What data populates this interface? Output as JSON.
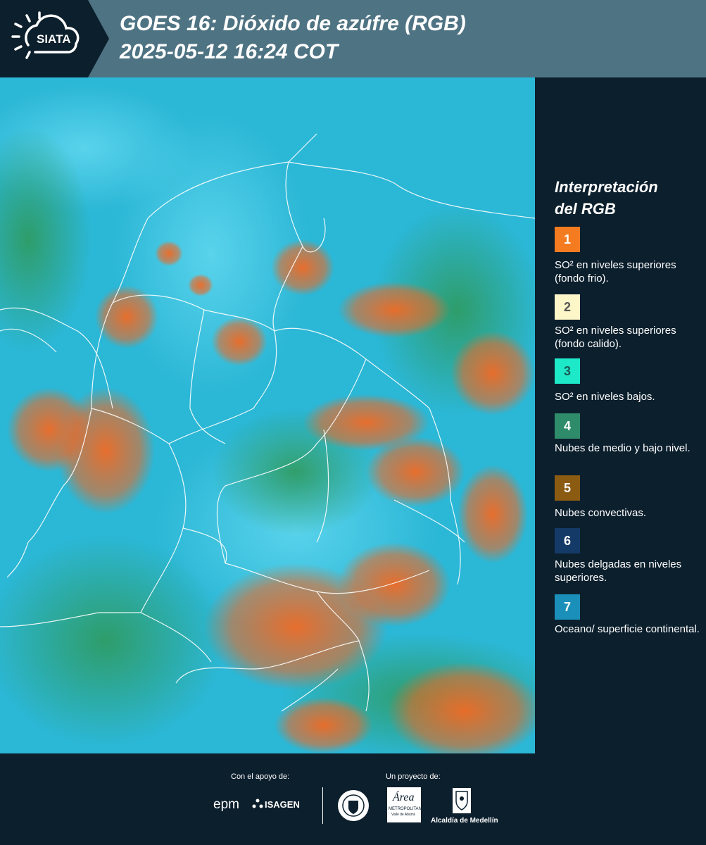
{
  "header": {
    "logo_text": "SIATA",
    "title_line1": "GOES 16: Dióxido de azúfre (RGB)",
    "title_line2": " 2025-05-12 16:24 COT"
  },
  "legend": {
    "title_line1": "Interpretación",
    "title_line2": "del RGB",
    "items": [
      {
        "num": "1",
        "color": "#f47b20",
        "text_color": "#ffffff",
        "label": "SO² en niveles superiores (fondo frio)."
      },
      {
        "num": "2",
        "color": "#fdf6c9",
        "text_color": "#555555",
        "label": "SO² en niveles superiores (fondo calido)."
      },
      {
        "num": "3",
        "color": "#1de9c9",
        "text_color": "#1a5a55",
        "label": "SO² en niveles bajos."
      },
      {
        "num": "4",
        "color": "#2e8c6a",
        "text_color": "#ffffff",
        "label": "Nubes de medio y bajo nivel."
      },
      {
        "num": "5",
        "color": "#8c5b12",
        "text_color": "#ffffff",
        "label": "Nubes convectivas."
      },
      {
        "num": "6",
        "color": "#143a68",
        "text_color": "#ffffff",
        "label": "Nubes delgadas en niveles superiores."
      },
      {
        "num": "7",
        "color": "#1a8fb9",
        "text_color": "#ffffff",
        "label": "Oceano/ superficie continental."
      }
    ]
  },
  "footer": {
    "support_label": "Con el apoyo de:",
    "project_label": "Un proyecto de:",
    "logo_epm": "epm",
    "logo_isagen": "ISAGEN",
    "logo_area": "Área",
    "logo_area_sub": "METROPOLITANA",
    "logo_area_sub2": "Valle de Aburrá",
    "logo_alcaldia": "Alcaldía de Medellín"
  },
  "map": {
    "icon": "satellite-image"
  }
}
